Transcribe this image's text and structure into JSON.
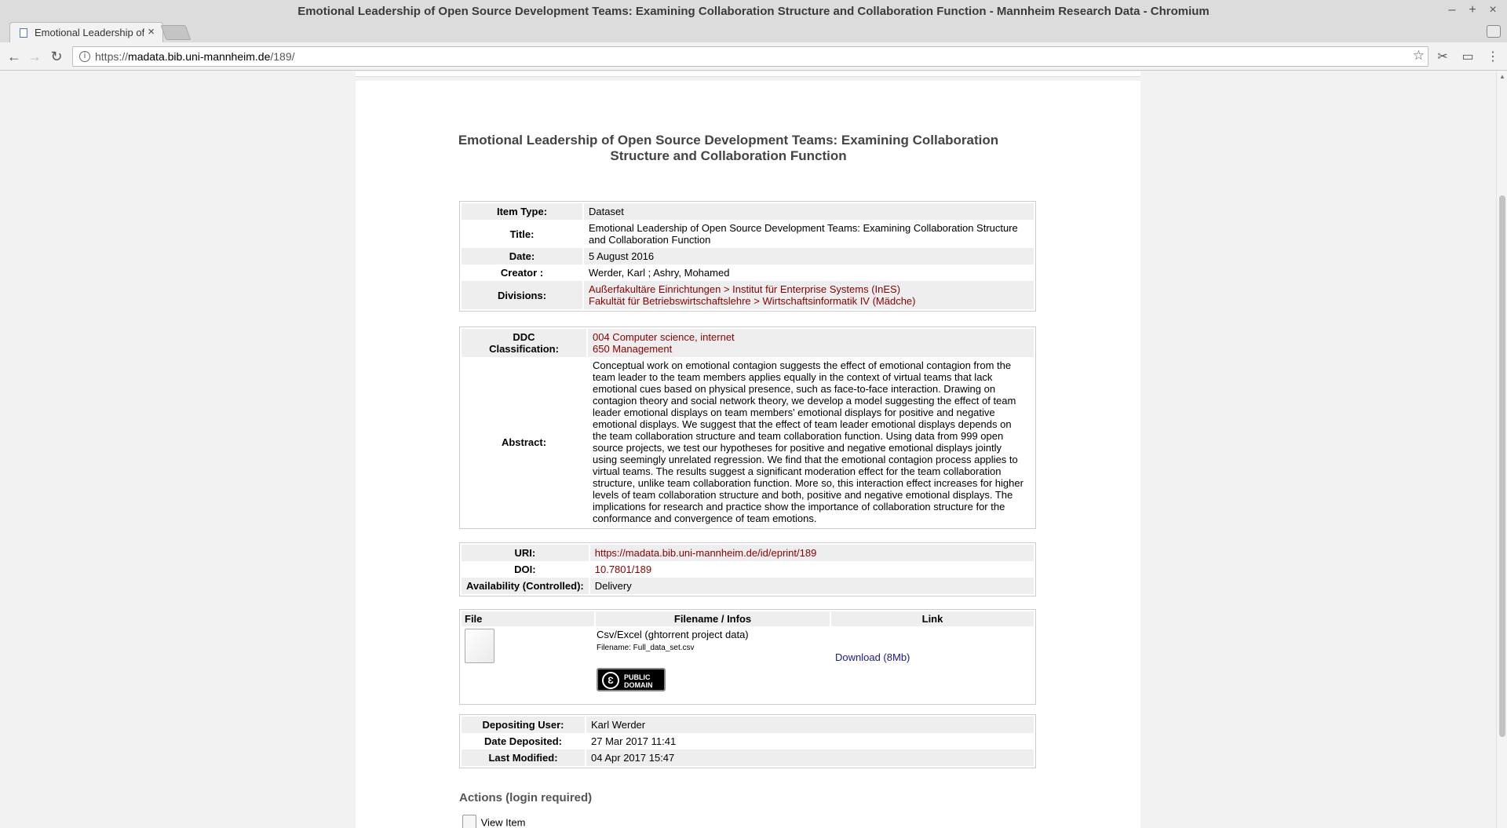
{
  "window": {
    "title": "Emotional Leadership of Open Source Development Teams: Examining Collaboration Structure and Collaboration Function - Mannheim Research Data - Chromium",
    "tab_title": "Emotional Leadership of",
    "url_scheme": "https://",
    "url_host": "madata.bib.uni-mannheim.de",
    "url_path": "/189/"
  },
  "page": {
    "heading": "Emotional Leadership of Open Source Development Teams: Examining Collaboration Structure and Collaboration Function"
  },
  "summary": {
    "item_type_label": "Item Type:",
    "item_type": "Dataset",
    "title_label": "Title:",
    "title": "Emotional Leadership of Open Source Development Teams: Examining Collaboration Structure and Collaboration Function",
    "date_label": "Date:",
    "date": "5 August 2016",
    "creator_label": "Creator :",
    "creator": "Werder, Karl ; Ashry, Mohamed",
    "divisions_label": "Divisions:",
    "divisions": [
      "Außerfakultäre Einrichtungen > Institut für Enterprise Systems (InES)",
      "Fakultät für Betriebswirtschaftslehre > Wirtschaftsinformatik IV (Mädche)"
    ]
  },
  "details": {
    "ddc_label_1": "DDC",
    "ddc_label_2": "Classification:",
    "ddc": [
      "004 Computer science, internet",
      "650 Management"
    ],
    "abstract_label": "Abstract:",
    "abstract": "Conceptual work on emotional contagion suggests the effect of emotional contagion from the team leader to the team members applies equally in the context of virtual teams that lack emotional cues based on physical presence, such as face-to-face interaction. Drawing on contagion theory and social network theory, we develop a model suggesting the effect of team leader emotional displays on team members' emotional displays for positive and negative emotional displays. We suggest that the effect of team leader emotional displays depends on the team collaboration structure and team collaboration function. Using data from 999 open source projects, we test our hypotheses for positive and negative emotional displays jointly using seemingly unrelated regression. We find that the emotional contagion process applies to virtual teams. The results suggest a significant moderation effect for the team collaboration structure, unlike team collaboration function. More so, this interaction effect increases for higher levels of team collaboration structure and both, positive and negative emotional displays. The implications for research and practice show the importance of collaboration structure for the conformance and convergence of team emotions."
  },
  "identifiers": {
    "uri_label": "URI:",
    "uri": "https://madata.bib.uni-mannheim.de/id/eprint/189",
    "doi_label": "DOI:",
    "doi": "10.7801/189",
    "availability_label": "Availability (Controlled):",
    "availability": "Delivery"
  },
  "files": {
    "headers": [
      "File",
      "Filename / Infos",
      "Link"
    ],
    "name": "Csv/Excel (ghtorrent project data)",
    "filename": "Filename: Full_data_set.csv",
    "license_line1": "PUBLIC",
    "license_line2": "DOMAIN",
    "download": "Download (8Mb)"
  },
  "deposit": {
    "user_label": "Depositing User:",
    "user": "Karl Werder",
    "deposited_label": "Date Deposited:",
    "deposited": "27 Mar 2017 11:41",
    "modified_label": "Last Modified:",
    "modified": "04 Apr 2017 15:47"
  },
  "actions": {
    "heading": "Actions (login required)",
    "view_item": "View Item"
  }
}
